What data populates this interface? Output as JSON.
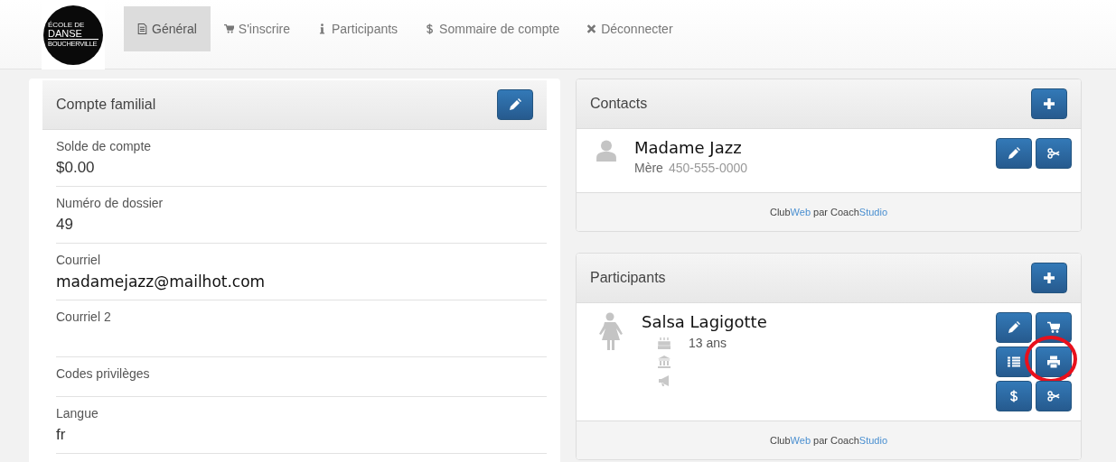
{
  "logo": {
    "lines": [
      "ÉCOLE DE",
      "DANSE",
      "BOUCHERVILLE"
    ]
  },
  "nav": [
    {
      "label": "Général",
      "selected": true
    },
    {
      "label": "S'inscrire",
      "selected": false
    },
    {
      "label": "Participants",
      "selected": false
    },
    {
      "label": "Sommaire de compte",
      "selected": false
    },
    {
      "label": "Déconnecter",
      "selected": false
    }
  ],
  "account": {
    "title": "Compte familial",
    "fields": [
      {
        "label": "Solde de compte",
        "value": "$0.00",
        "kind": "text"
      },
      {
        "label": "Numéro de dossier",
        "value": "49",
        "kind": "text"
      },
      {
        "label": "Courriel",
        "value": "madamejazz@mailhot.com",
        "kind": "handwritten"
      },
      {
        "label": "Courriel 2",
        "kind": "blank"
      },
      {
        "label": "Codes privilèges",
        "kind": "compact"
      },
      {
        "label": "Langue",
        "value": "fr",
        "kind": "text"
      }
    ]
  },
  "contacts": {
    "title": "Contacts",
    "items": [
      {
        "name": "Madame Jazz",
        "relation": "Mère",
        "phone": "450-555-0000",
        "actions": [
          {
            "highlighted": false
          },
          {
            "highlighted": false
          }
        ]
      }
    ],
    "footer": [
      "Club",
      "Web",
      " par Coach",
      "Studio"
    ]
  },
  "participants": {
    "title": "Participants",
    "items": [
      {
        "name": "Salsa Lagigotte",
        "age": "13 ans",
        "actions": [
          {
            "highlighted": false
          },
          {
            "highlighted": false
          },
          {
            "highlighted": false
          },
          {
            "highlighted": true
          },
          {
            "highlighted": false
          },
          {
            "highlighted": false
          }
        ]
      }
    ],
    "footer": [
      "Club",
      "Web",
      " par Coach",
      "Studio"
    ]
  }
}
